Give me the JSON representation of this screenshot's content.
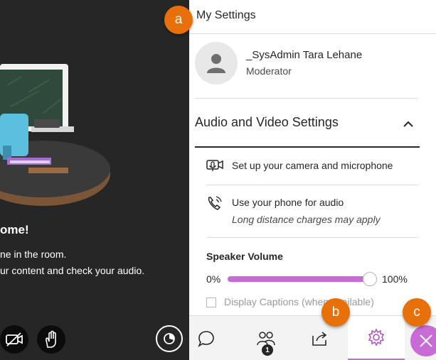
{
  "stage": {
    "welcome_title": "ome!",
    "welcome_line1": "ne in the room.",
    "welcome_line2": "ur content and check your audio.",
    "camera_button_icon": "camera-off-icon",
    "hand_button_icon": "raise-hand-icon",
    "status_button_icon": "status-clock-icon"
  },
  "panel": {
    "title": "My Settings",
    "user": {
      "name": "_SysAdmin Tara Lehane",
      "role": "Moderator",
      "avatar_icon": "user-avatar-icon"
    },
    "section": {
      "title": "Audio and Video Settings",
      "toggle_icon": "chevron-up-icon",
      "options": [
        {
          "icon": "camera-microphone-icon",
          "label": "Set up your camera and microphone"
        },
        {
          "icon": "phone-icon",
          "label": "Use your phone for audio",
          "sublabel": "Long distance charges may apply"
        }
      ],
      "speaker_volume": {
        "label": "Speaker Volume",
        "min_label": "0%",
        "max_label": "100%",
        "level": 0.95
      },
      "captions": {
        "label": "Display Captions (when available)",
        "checked": false
      }
    }
  },
  "tabbar": {
    "tabs": [
      {
        "name": "chat",
        "icon": "chat-icon"
      },
      {
        "name": "attendees",
        "icon": "attendees-icon",
        "badge": "1"
      },
      {
        "name": "share-content",
        "icon": "share-icon"
      },
      {
        "name": "my-settings",
        "icon": "gear-icon",
        "selected": true
      },
      {
        "name": "close-panel",
        "icon": "close-icon"
      }
    ]
  },
  "callouts": [
    "a",
    "b",
    "c"
  ],
  "colors": {
    "accent": "#c96bd6",
    "callout": "#e8700a",
    "stage_bg": "#262626",
    "text": "#262626"
  }
}
